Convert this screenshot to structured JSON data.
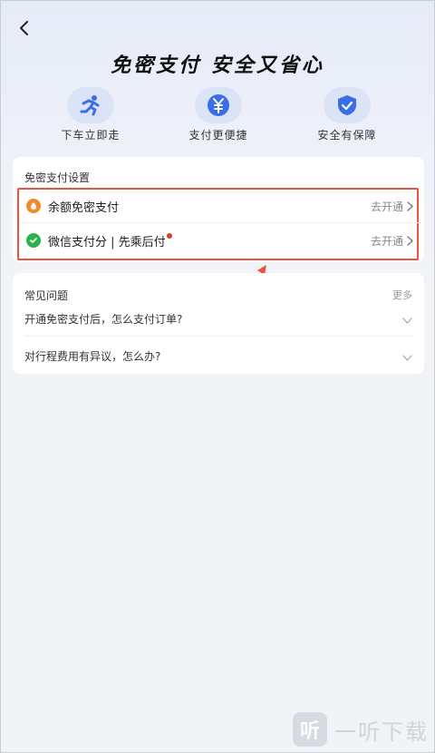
{
  "hero": {
    "title": "免密支付 安全又省心"
  },
  "features": [
    {
      "label": "下车立即走",
      "icon": "running-person-icon"
    },
    {
      "label": "支付更便捷",
      "icon": "yen-coin-icon"
    },
    {
      "label": "安全有保障",
      "icon": "shield-check-icon"
    }
  ],
  "settings": {
    "title": "免密支付设置",
    "rows": [
      {
        "name": "余额免密支付",
        "action": "去开通",
        "icon": "balance-icon",
        "icon_color": "#f08a2a"
      },
      {
        "name": "微信支付分 | 先乘后付",
        "action": "去开通",
        "icon": "wechat-pay-icon",
        "icon_color": "#2bb24c",
        "badge": true
      }
    ]
  },
  "faq": {
    "title": "常见问题",
    "more": "更多",
    "items": [
      {
        "question": "开通免密支付后，怎么支付订单?"
      },
      {
        "question": "对行程费用有异议，怎么办?"
      }
    ]
  },
  "watermark": {
    "text": "一听下载",
    "logo": "听"
  },
  "colors": {
    "accent": "#3a6ee8",
    "highlight": "#f0503c",
    "background": "#f2f3f7"
  }
}
